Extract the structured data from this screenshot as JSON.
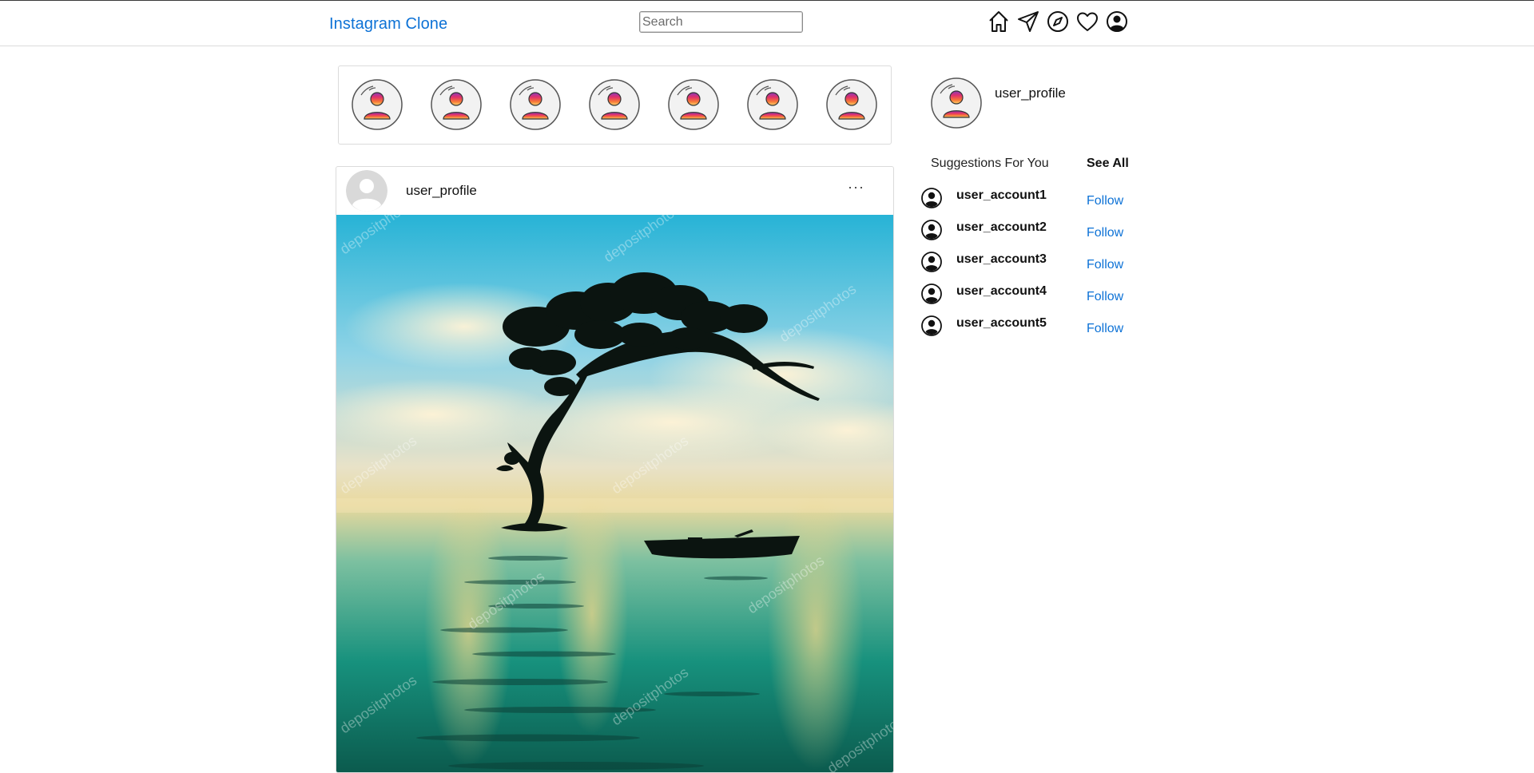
{
  "app": {
    "title": "Instagram Clone"
  },
  "search": {
    "placeholder": "Search",
    "value": ""
  },
  "nav": {
    "icons": [
      "home-icon",
      "send-icon",
      "explore-icon",
      "heart-icon",
      "profile-icon"
    ]
  },
  "colors": {
    "link": "#0d72d6",
    "border": "#dbdbdb",
    "story_gradient": [
      "#c13584",
      "#e1306c",
      "#f77737",
      "#fcaf45"
    ]
  },
  "stories": {
    "count": 7
  },
  "post": {
    "username": "user_profile",
    "more_label": "···",
    "image_watermark": "depositphotos"
  },
  "sidebar": {
    "username": "user_profile",
    "suggestions_title": "Suggestions For You",
    "see_all": "See All",
    "suggestions": [
      {
        "name": "user_account1",
        "action": "Follow"
      },
      {
        "name": "user_account2",
        "action": "Follow"
      },
      {
        "name": "user_account3",
        "action": "Follow"
      },
      {
        "name": "user_account4",
        "action": "Follow"
      },
      {
        "name": "user_account5",
        "action": "Follow"
      }
    ]
  }
}
